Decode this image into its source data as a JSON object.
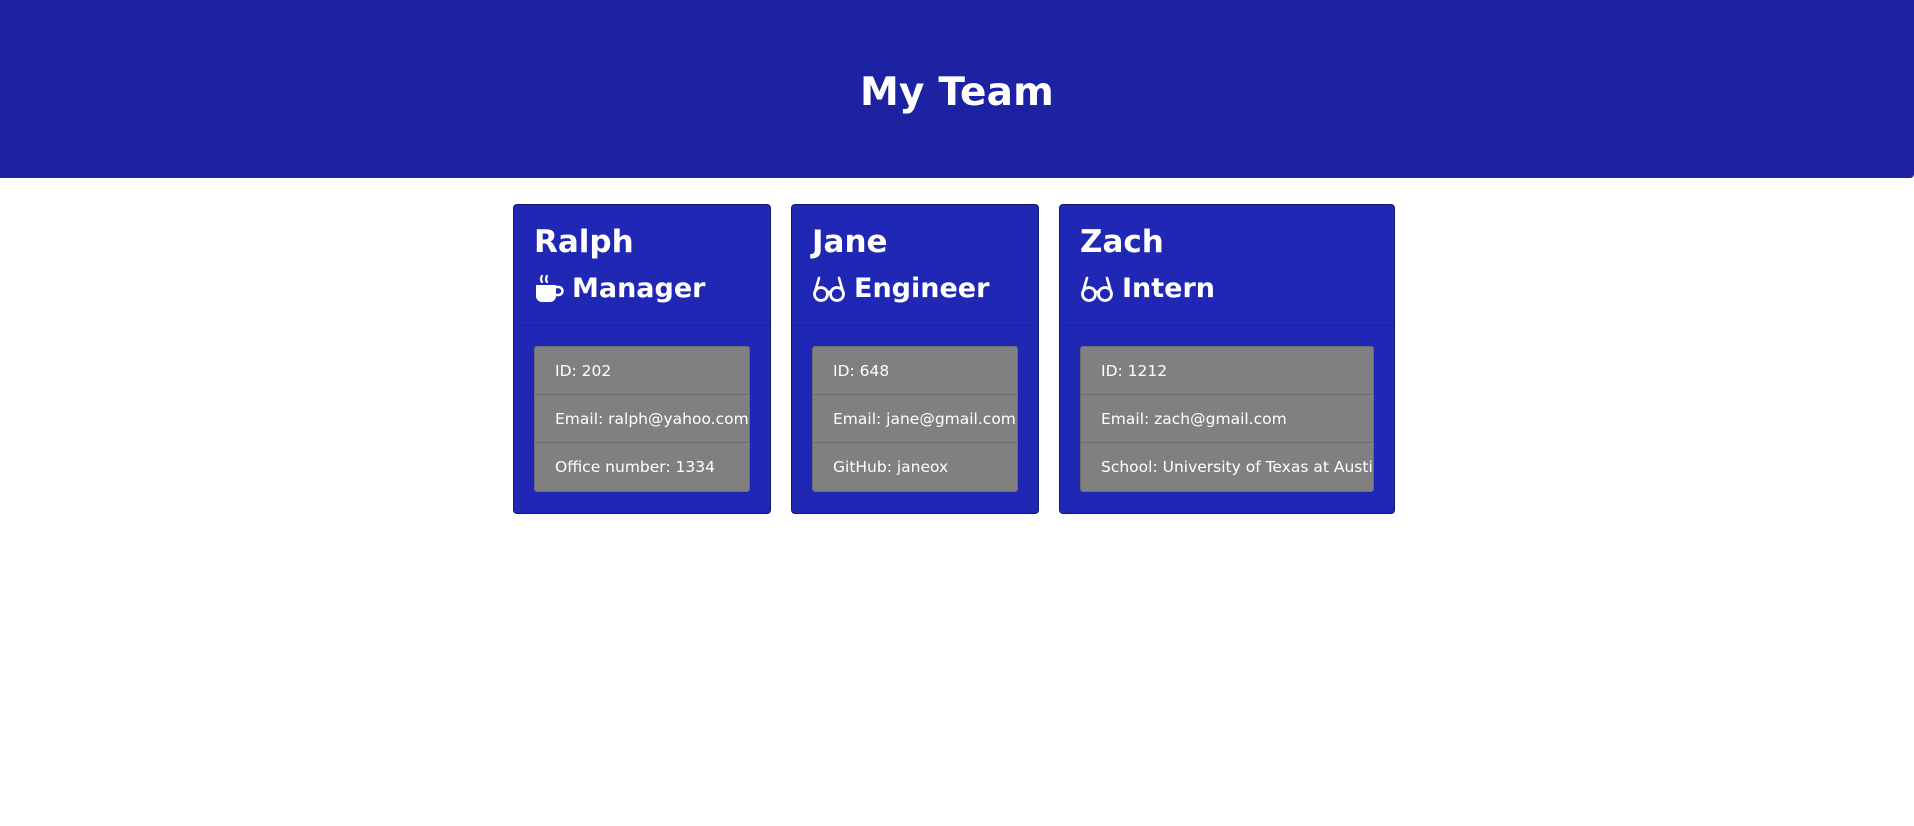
{
  "header": {
    "title": "My Team"
  },
  "colors": {
    "header_bg": "#1c22a1",
    "card_bg": "#2027b5",
    "list_bg": "#808080",
    "text": "#ffffff"
  },
  "team": [
    {
      "name": "Ralph",
      "role": "Manager",
      "role_icon": "coffee-mug-icon",
      "details": [
        "ID: 202",
        "Email: ralph@yahoo.com",
        "Office number: 1334"
      ]
    },
    {
      "name": "Jane",
      "role": "Engineer",
      "role_icon": "glasses-icon",
      "details": [
        "ID: 648",
        "Email: jane@gmail.com",
        "GitHub: janeox"
      ]
    },
    {
      "name": "Zach",
      "role": "Intern",
      "role_icon": "glasses-icon",
      "details": [
        "ID: 1212",
        "Email: zach@gmail.com",
        "School: University of Texas at Austin"
      ]
    }
  ]
}
